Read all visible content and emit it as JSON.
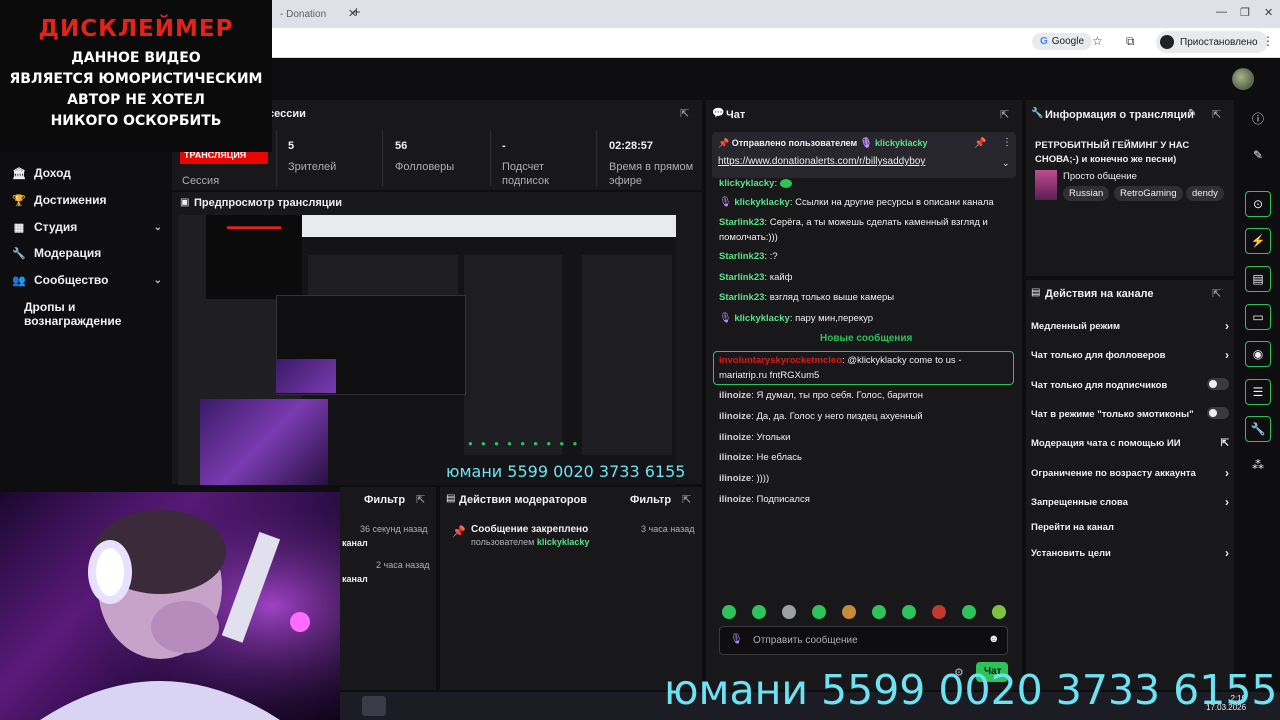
{
  "browser": {
    "tab_title": "- Donation",
    "new_tab": "+",
    "google_label": "Google",
    "paused_label": "Приостановлено"
  },
  "disclaimer": {
    "title": "ДИСКЛЕЙМЕР",
    "lines": [
      "ДАННОЕ ВИДЕО",
      "ЯВЛЯЕТСЯ ЮМОРИСТИЧЕСКИМ",
      "АВТОР НЕ ХОТЕЛ",
      "НИКОГО ОСКОРБИТЬ"
    ]
  },
  "sidebar": {
    "items": [
      {
        "label": "Доход",
        "icon": "bank-icon"
      },
      {
        "label": "Достижения",
        "icon": "trophy-icon"
      },
      {
        "label": "Студия",
        "icon": "grid-icon"
      },
      {
        "label": "Модерация",
        "icon": "wrench-icon"
      },
      {
        "label": "Сообщество",
        "icon": "people-icon"
      },
      {
        "label": "Дропы и вознаграждение",
        "icon": ""
      }
    ]
  },
  "session": {
    "title_fragment": "сессии",
    "live_label": "ТРАНСЛЯЦИЯ",
    "session_label": "Сессия",
    "stats": [
      {
        "value": "5",
        "label": "Зрителей"
      },
      {
        "value": "56",
        "label": "Фолловеры"
      },
      {
        "value": "-",
        "label": "Подсчет подписок"
      },
      {
        "value": "02:28:57",
        "label": "Время в прямом эфире"
      }
    ]
  },
  "preview": {
    "title": "Предпросмотр трансляции"
  },
  "activity": {
    "filter_label": "Фильтр",
    "items": [
      {
        "time": "36 секунд назад",
        "text": "канал"
      },
      {
        "time": "2 часа назад",
        "text": "канал"
      }
    ]
  },
  "mod_actions": {
    "title": "Действия модераторов",
    "filter_label": "Фильтр",
    "item_title": "Сообщение закреплено",
    "item_by": "пользователем",
    "item_user": "klickyklacky",
    "item_time": "3 часа назад"
  },
  "chat": {
    "title": "Чат",
    "pinned_by": "Отправлено пользователем",
    "pinned_user": "klickyklacky",
    "pinned_link": "https://www.donationalerts.com/r/billysaddyboy",
    "new_messages": "Новые сообщения",
    "messages": [
      {
        "user": "klickyklacky",
        "text": ""
      },
      {
        "user": "klickyklacky",
        "text": "Ссылки на другие ресурсы в описани канала"
      },
      {
        "user": "Starlink23",
        "text": "Серёга, а ты можешь сделать каменный взгляд и помолчать:)))"
      },
      {
        "user": "Starlink23",
        "text": ":?"
      },
      {
        "user": "Starlink23",
        "text": "кайф"
      },
      {
        "user": "Starlink23",
        "text": "взгляд только выше камеры"
      },
      {
        "user": "klickyklacky",
        "text": "пару мин,перекур"
      },
      {
        "user": "involuntaryskyrocketmcleo",
        "text": "@klickyklacky come to us - mariatrip.ru fntRGXum5"
      },
      {
        "user": "ilinoize",
        "text": "Я думал, ты про себя. Голос, баритон"
      },
      {
        "user": "ilinoize",
        "text": "Да, да. Голос у него пиздец ахуенный"
      },
      {
        "user": "ilinoize",
        "text": "Угольки"
      },
      {
        "user": "ilinoize",
        "text": "Не еблась"
      },
      {
        "user": "ilinoize",
        "text": "))))"
      },
      {
        "user": "ilinoize",
        "text": "Подписался"
      }
    ],
    "input_placeholder": "Отправить сообщение",
    "send_label": "Чат"
  },
  "stream_info": {
    "title": "Информация о трансляции",
    "stream_title": "РЕТРОБИТНЫЙ ГЕЙМИНГ У НАС СНОВА;-) и конечно же песни)",
    "category": "Просто общение",
    "tags": [
      "Russian",
      "RetroGaming",
      "dendy"
    ]
  },
  "channel_actions": {
    "title": "Действия на канале",
    "rows": [
      {
        "label": "Медленный режим",
        "kind": "arrow"
      },
      {
        "label": "Чат только для фолловеров",
        "kind": "arrow"
      },
      {
        "label": "Чат только для подписчиков",
        "kind": "toggle"
      },
      {
        "label": "Чат в режиме \"только эмотиконы\"",
        "kind": "toggle"
      },
      {
        "label": "Модерация чата с помощью ИИ",
        "kind": "external"
      },
      {
        "label": "Ограничение по возрасту аккаунта",
        "kind": "arrow"
      },
      {
        "label": "Запрещенные слова",
        "kind": "arrow"
      },
      {
        "label": "Перейти на канал",
        "kind": "none"
      },
      {
        "label": "Установить цели",
        "kind": "arrow"
      }
    ]
  },
  "overlay": {
    "donate_text": "юмани 5599 0020 3733 6155"
  },
  "taskbar": {
    "time": "2:19",
    "date": "17.03.2026"
  },
  "colors": {
    "accent_green": "#2ec25b",
    "live_red": "#eb0400",
    "disclaimer_red": "#e2231a",
    "donate_cyan": "#6de2f2"
  }
}
